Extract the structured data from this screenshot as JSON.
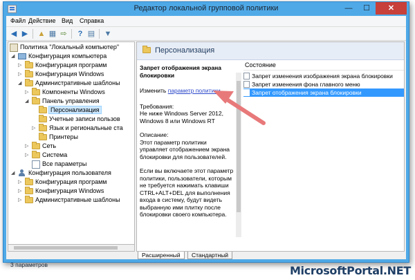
{
  "window": {
    "title": "Редактор локальной групповой политики"
  },
  "menu": [
    "Файл",
    "Действие",
    "Вид",
    "Справка"
  ],
  "toolbar": {
    "icons": [
      "back-arrow-icon",
      "forward-arrow-icon",
      "up-folder-icon",
      "show-hide-tree-icon",
      "export-list-icon",
      "help-icon",
      "properties-icon",
      "filter-icon"
    ]
  },
  "tree": {
    "items": [
      {
        "label": "Политика \"Локальный компьютер\""
      },
      {
        "label": "Конфигурация компьютера"
      },
      {
        "label": "Конфигурация программ"
      },
      {
        "label": "Конфигурация Windows"
      },
      {
        "label": "Административные шаблоны"
      },
      {
        "label": "Компоненты Windows"
      },
      {
        "label": "Панель управления"
      },
      {
        "label": "Персонализация"
      },
      {
        "label": "Учетные записи пользов"
      },
      {
        "label": "Язык и региональные ста"
      },
      {
        "label": "Принтеры"
      },
      {
        "label": "Сеть"
      },
      {
        "label": "Система"
      },
      {
        "label": "Все параметры"
      },
      {
        "label": "Конфигурация пользователя"
      },
      {
        "label": "Конфигурация программ"
      },
      {
        "label": "Конфигурация Windows"
      },
      {
        "label": "Административные шаблоны"
      }
    ]
  },
  "right": {
    "header_title": "Персонализация",
    "description": {
      "title": "Запрет отображения экрана блокировки",
      "edit_prefix": "Изменить",
      "edit_link": "параметр политики",
      "requirements_label": "Требования:",
      "requirements_text": "Не ниже Windows Server 2012, Windows 8 или Windows RT",
      "description_label": "Описание:",
      "description_text": "Этот параметр политики управляет отображением экрана блокировки для пользователей.",
      "description_more": "Если вы включаете этот параметр политики, пользователи, которым не требуется нажимать клавиши CTRL+ALT+DEL для выполнения входа в систему, будут видеть выбранную ими плитку после блокировки своего компьютера."
    },
    "list_header": "Состояние",
    "list_items": [
      {
        "label": "Запрет изменения изображения экрана блокировки"
      },
      {
        "label": "Запрет изменения фона главного меню"
      },
      {
        "label": "Запрет отображения экрана блокировки"
      }
    ]
  },
  "tabs": {
    "extended": "Расширенный",
    "standard": "Стандартный"
  },
  "status": {
    "text": "3 параметров"
  },
  "watermark": "MicrosoftPortal.NET",
  "colors": {
    "titlebar": "#4fa9e7",
    "selection": "#3399ff",
    "arrow": "#e8797a",
    "close_button": "#c7403a"
  }
}
